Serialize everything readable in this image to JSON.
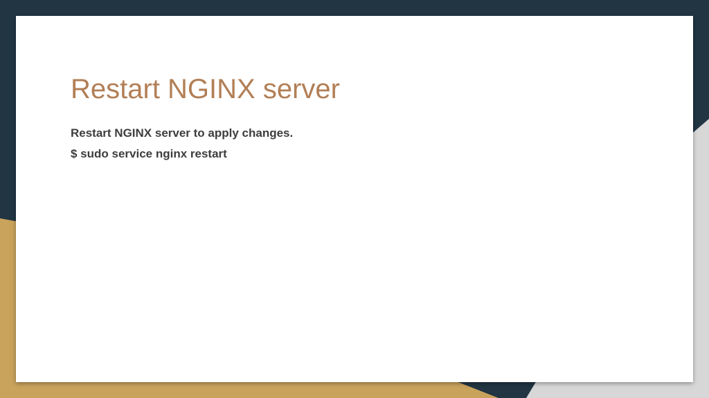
{
  "slide": {
    "title": "Restart NGINX server",
    "body_lines": [
      "Restart NGINX server to apply changes.",
      "$ sudo service nginx restart"
    ]
  },
  "colors": {
    "navy_background": "#213543",
    "gold_band": "#c9a35c",
    "grey_band": "#d7d7d7",
    "card": "#ffffff",
    "title": "#b27f56",
    "body_text": "#3d3d3d"
  }
}
